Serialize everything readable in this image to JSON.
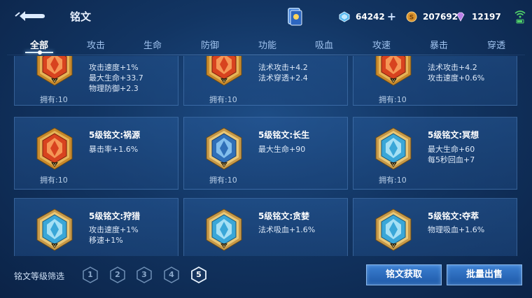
{
  "header": {
    "title": "铭文",
    "resources": [
      {
        "name": "diamond",
        "value": "64242",
        "has_plus": true,
        "color": "#57b8f0"
      },
      {
        "name": "coupon",
        "value": "207692",
        "has_plus": false,
        "color": "#d9932e"
      },
      {
        "name": "gem",
        "value": "12197",
        "has_plus": false,
        "color": "#b97ee8"
      }
    ]
  },
  "tabs": [
    {
      "label": "全部",
      "active": true
    },
    {
      "label": "攻击",
      "active": false
    },
    {
      "label": "生命",
      "active": false
    },
    {
      "label": "防御",
      "active": false
    },
    {
      "label": "功能",
      "active": false
    },
    {
      "label": "吸血",
      "active": false
    },
    {
      "label": "攻速",
      "active": false
    },
    {
      "label": "暴击",
      "active": false
    },
    {
      "label": "穿透",
      "active": false
    }
  ],
  "inscriptions": [
    {
      "name": "",
      "attrs": [
        "攻击速度+1%",
        "最大生命+33.7",
        "物理防御+2.3"
      ],
      "owned": "拥有:10",
      "color": "red",
      "icon": "inscription-red-icon"
    },
    {
      "name": "",
      "attrs": [
        "法术攻击+4.2",
        "法术穿透+2.4"
      ],
      "owned": "拥有:10",
      "color": "red",
      "icon": "inscription-red-icon"
    },
    {
      "name": "",
      "attrs": [
        "法术攻击+4.2",
        "攻击速度+0.6%"
      ],
      "owned": "拥有:10",
      "color": "red",
      "icon": "inscription-red-icon"
    },
    {
      "name": "5级铭文:祸源",
      "attrs": [
        "暴击率+1.6%"
      ],
      "owned": "拥有:10",
      "color": "red",
      "icon": "inscription-red-icon"
    },
    {
      "name": "5级铭文:长生",
      "attrs": [
        "最大生命+90"
      ],
      "owned": "拥有:10",
      "color": "blue",
      "icon": "inscription-blue-icon"
    },
    {
      "name": "5级铭文:冥想",
      "attrs": [
        "最大生命+60",
        "每5秒回血+7"
      ],
      "owned": "拥有:10",
      "color": "cyan",
      "icon": "inscription-cyan-icon"
    },
    {
      "name": "5级铭文:狩猎",
      "attrs": [
        "攻击速度+1%",
        "移速+1%"
      ],
      "owned": "",
      "color": "cyan",
      "icon": "inscription-cyan-icon"
    },
    {
      "name": "5级铭文:贪婪",
      "attrs": [
        "法术吸血+1.6%"
      ],
      "owned": "",
      "color": "cyan",
      "icon": "inscription-cyan-icon"
    },
    {
      "name": "5级铭文:夺萃",
      "attrs": [
        "物理吸血+1.6%"
      ],
      "owned": "",
      "color": "cyan",
      "icon": "inscription-cyan-icon"
    }
  ],
  "footer": {
    "filter_label": "铭文等级筛选",
    "levels": [
      {
        "label": "1",
        "active": false
      },
      {
        "label": "2",
        "active": false
      },
      {
        "label": "3",
        "active": false
      },
      {
        "label": "4",
        "active": false
      },
      {
        "label": "5",
        "active": true
      }
    ],
    "obtain_button": "铭文获取",
    "sell_button": "批量出售"
  }
}
